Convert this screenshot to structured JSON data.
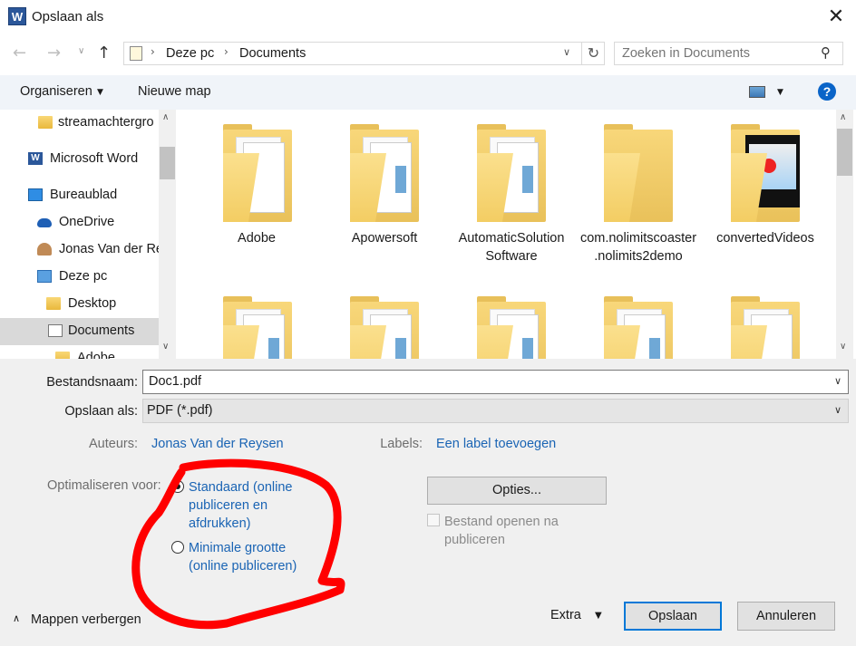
{
  "window": {
    "title": "Opslaan als",
    "app_icon": "W",
    "close_glyph": "✕"
  },
  "address": {
    "breadcrumbs": [
      "Deze pc",
      "Documents"
    ],
    "search_placeholder": "Zoeken in Documents"
  },
  "toolbar": {
    "organize_label": "Organiseren",
    "new_folder_label": "Nieuwe map",
    "help_glyph": "?"
  },
  "nav": {
    "items": [
      {
        "label": "streamachtergro",
        "icon": "folder-icon"
      },
      {
        "label": "Microsoft Word",
        "icon": "word-icon"
      },
      {
        "label": "Bureaublad",
        "icon": "desktop-icon"
      },
      {
        "label": "OneDrive",
        "icon": "cloud-icon"
      },
      {
        "label": "Jonas Van der Re",
        "icon": "user-icon"
      },
      {
        "label": "Deze pc",
        "icon": "pc-icon"
      },
      {
        "label": "Desktop",
        "icon": "folder-icon"
      },
      {
        "label": "Documents",
        "icon": "documents-icon",
        "selected": true
      },
      {
        "label": "Adobe",
        "icon": "folder-icon"
      }
    ]
  },
  "files": [
    {
      "name": "Adobe"
    },
    {
      "name": "Apowersoft"
    },
    {
      "name": "AutomaticSolution Software"
    },
    {
      "name": "com.nolimitscoaster.nolimits2demo"
    },
    {
      "name": "convertedVideos"
    }
  ],
  "form": {
    "filename_label": "Bestandsnaam:",
    "filename_value": "Doc1.pdf",
    "saveas_label": "Opslaan als:",
    "saveas_value": "PDF (*.pdf)",
    "authors_label": "Auteurs:",
    "authors_value": "Jonas Van der Reysen",
    "tags_label": "Labels:",
    "tags_value": "Een label toevoegen",
    "optimize_label": "Optimaliseren voor:",
    "radio_standard": "Standaard (online publiceren en afdrukken)",
    "radio_min": "Minimale grootte (online publiceren)",
    "options_label": "Opties...",
    "open_after_label": "Bestand openen na publiceren"
  },
  "footer": {
    "hide_folders_label": "Mappen verbergen",
    "extra_label": "Extra",
    "save_label": "Opslaan",
    "cancel_label": "Annuleren"
  },
  "colors": {
    "link": "#1a64b4",
    "accent": "#0078d7",
    "annotation": "#ff0000"
  }
}
